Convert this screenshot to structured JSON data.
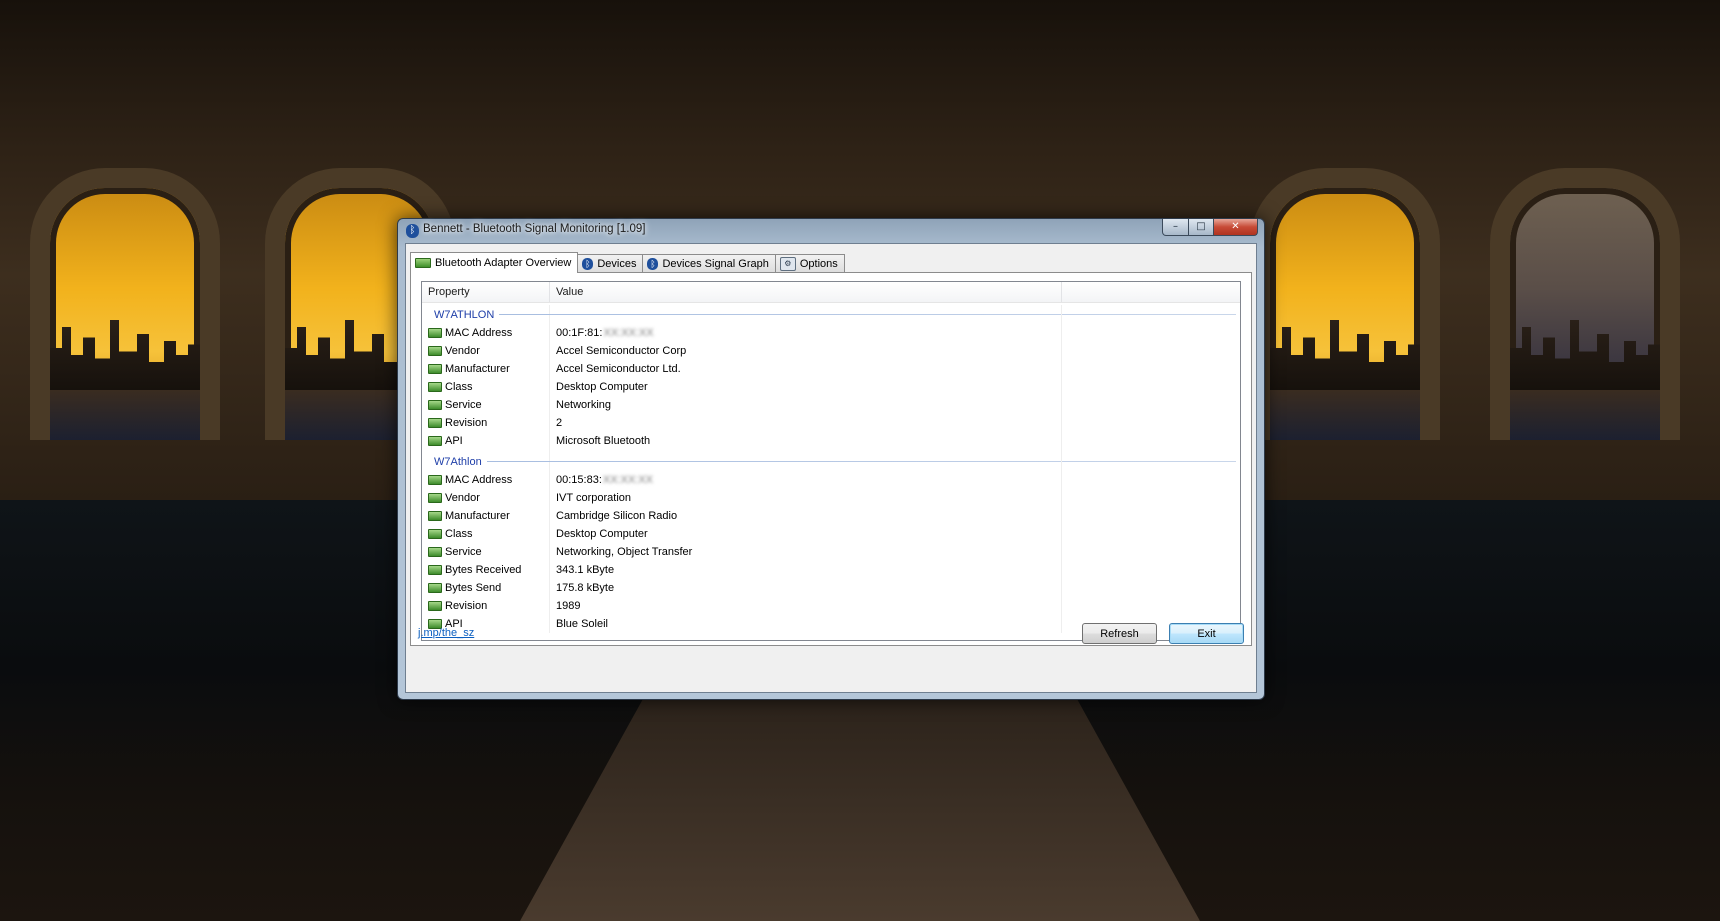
{
  "window": {
    "title": "Bennett - Bluetooth Signal Monitoring [1.09]",
    "caption_buttons": {
      "minimize": "–",
      "maximize": "□",
      "close": "✕"
    }
  },
  "tabs": [
    {
      "label": "Bluetooth Adapter Overview",
      "icon": "adapter-icon",
      "active": true
    },
    {
      "label": "Devices",
      "icon": "bluetooth-icon",
      "active": false
    },
    {
      "label": "Devices Signal Graph",
      "icon": "bluetooth-icon",
      "active": false
    },
    {
      "label": "Options",
      "icon": "options-icon",
      "active": false
    }
  ],
  "table": {
    "columns": [
      "Property",
      "Value"
    ],
    "groups": [
      {
        "name": "W7ATHLON",
        "rows": [
          {
            "property": "MAC Address",
            "value": "00:1F:81:",
            "value_obscured": "XX:XX:XX"
          },
          {
            "property": "Vendor",
            "value": "Accel Semiconductor Corp"
          },
          {
            "property": "Manufacturer",
            "value": "Accel Semiconductor Ltd."
          },
          {
            "property": "Class",
            "value": "Desktop Computer"
          },
          {
            "property": "Service",
            "value": "Networking"
          },
          {
            "property": "Revision",
            "value": "2"
          },
          {
            "property": "API",
            "value": "Microsoft Bluetooth"
          }
        ]
      },
      {
        "name": "W7Athlon",
        "rows": [
          {
            "property": "MAC Address",
            "value": "00:15:83:",
            "value_obscured": "XX:XX:XX"
          },
          {
            "property": "Vendor",
            "value": "IVT corporation"
          },
          {
            "property": "Manufacturer",
            "value": "Cambridge Silicon Radio"
          },
          {
            "property": "Class",
            "value": "Desktop Computer"
          },
          {
            "property": "Service",
            "value": "Networking, Object Transfer"
          },
          {
            "property": "Bytes Received",
            "value": "343.1 kByte"
          },
          {
            "property": "Bytes Send",
            "value": "175.8 kByte"
          },
          {
            "property": "Revision",
            "value": "1989"
          },
          {
            "property": "API",
            "value": "Blue Soleil"
          }
        ]
      }
    ]
  },
  "footer": {
    "link": "j.mp/the_sz",
    "refresh_label": "Refresh",
    "exit_label": "Exit"
  },
  "colors": {
    "group_header": "#1e3ea8",
    "link": "#0b5fc1",
    "close_button": "#c74a36"
  }
}
